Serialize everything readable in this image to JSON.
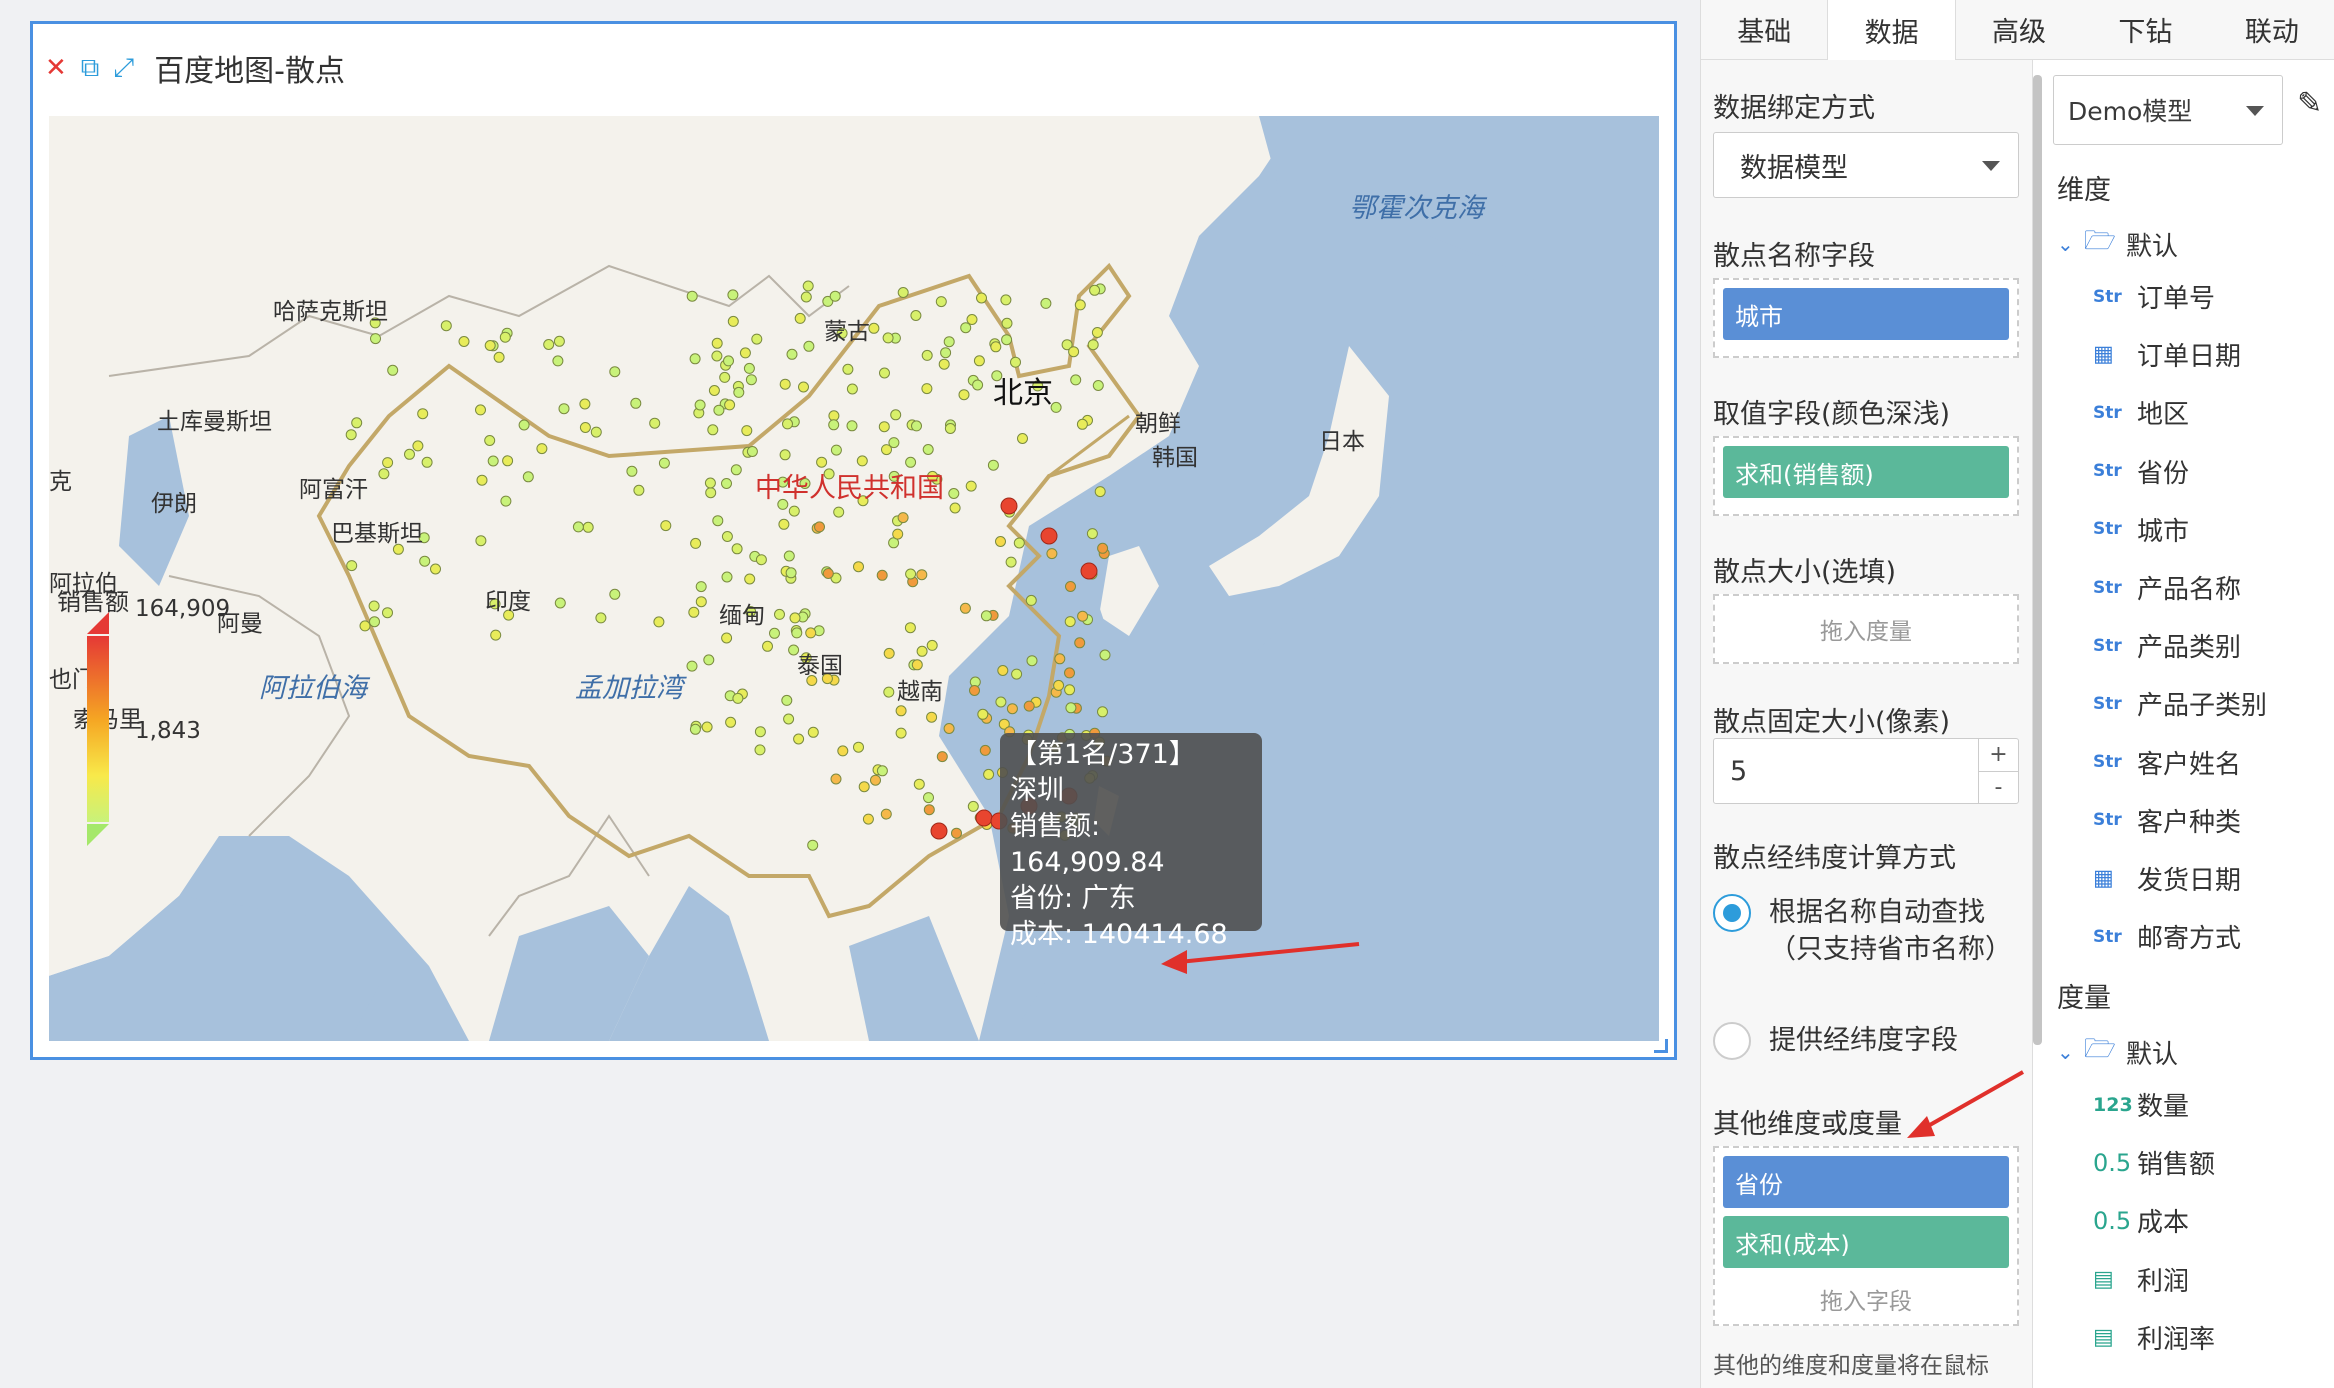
{
  "widget": {
    "title": "百度地图-散点",
    "controls": {
      "close": "close-icon",
      "copy": "copy-icon",
      "expand": "expand-icon"
    }
  },
  "map": {
    "labels": {
      "kazakhstan": "哈萨克斯坦",
      "mongolia": "蒙古",
      "turkmenistan": "土库曼斯坦",
      "afghanistan": "阿富汗",
      "iran": "伊朗",
      "pakistan": "巴基斯坦",
      "india": "印度",
      "myanmar": "缅甸",
      "thailand": "泰国",
      "vietnam": "越南",
      "beijing": "北京",
      "china": "中华人民共和国",
      "north_korea": "朝鲜",
      "south_korea": "韩国",
      "japan": "日本",
      "okhotsk": "鄂霍次克海",
      "arabian_sea": "阿拉伯海",
      "bay_of_bengal": "孟加拉湾",
      "oman": "阿曼",
      "arabia": "阿拉伯",
      "yemen": "也门",
      "somalia": "索马里",
      "edge": "克"
    },
    "tooltip": {
      "rank": "【第1名/371】",
      "city": "深圳",
      "sales": "销售额: 164,909.84",
      "province": "省份: 广东",
      "cost": "成本: 140414.68"
    },
    "legend": {
      "title": "销售额",
      "max": "164,909",
      "min": "1,843",
      "color_high": "#e53935",
      "color_low": "#c8f27a"
    }
  },
  "tabs": [
    {
      "label": "基础"
    },
    {
      "label": "数据"
    },
    {
      "label": "高级"
    },
    {
      "label": "下钻"
    },
    {
      "label": "联动"
    }
  ],
  "config": {
    "binding_label": "数据绑定方式",
    "binding_value": "数据模型",
    "name_field_label": "散点名称字段",
    "name_field_chip": "城市",
    "value_field_label": "取值字段(颜色深浅)",
    "value_field_chip": "求和(销售额)",
    "size_label": "散点大小(选填)",
    "size_hint": "拖入度量",
    "fixed_size_label": "散点固定大小(像素)",
    "fixed_size_value": "5",
    "spin_up": "+",
    "spin_down": "-",
    "geo_label": "散点经纬度计算方式",
    "geo_option1": "根据名称自动查找（只支持省市名称）",
    "geo_option2": "提供经纬度字段",
    "other_label": "其他维度或度量",
    "other_chip1": "省份",
    "other_chip2": "求和(成本)",
    "other_hint": "拖入字段",
    "note": "其他的维度和度量将在鼠标"
  },
  "fields": {
    "model": "Demo模型",
    "dimension_header": "维度",
    "dimension_folder": "默认",
    "dimensions": [
      {
        "type": "Str",
        "icon": "string-icon",
        "label": "订单号"
      },
      {
        "type": "cal",
        "icon": "calendar-icon",
        "label": "订单日期"
      },
      {
        "type": "Str",
        "icon": "string-icon",
        "label": "地区"
      },
      {
        "type": "Str",
        "icon": "string-icon",
        "label": "省份"
      },
      {
        "type": "Str",
        "icon": "string-icon",
        "label": "城市"
      },
      {
        "type": "Str",
        "icon": "string-icon",
        "label": "产品名称"
      },
      {
        "type": "Str",
        "icon": "string-icon",
        "label": "产品类别"
      },
      {
        "type": "Str",
        "icon": "string-icon",
        "label": "产品子类别"
      },
      {
        "type": "Str",
        "icon": "string-icon",
        "label": "客户姓名"
      },
      {
        "type": "Str",
        "icon": "string-icon",
        "label": "客户种类"
      },
      {
        "type": "cal",
        "icon": "calendar-icon",
        "label": "发货日期"
      },
      {
        "type": "Str",
        "icon": "string-icon",
        "label": "邮寄方式"
      }
    ],
    "measure_header": "度量",
    "measure_folder": "默认",
    "measures": [
      {
        "type": "123",
        "icon": "integer-icon",
        "label": "数量"
      },
      {
        "type": "0.5",
        "icon": "decimal-icon",
        "label": "销售额"
      },
      {
        "type": "0.5",
        "icon": "decimal-icon",
        "label": "成本"
      },
      {
        "type": "calc",
        "icon": "calculated-icon",
        "label": "利润"
      },
      {
        "type": "calc",
        "icon": "calculated-icon",
        "label": "利润率"
      }
    ]
  }
}
